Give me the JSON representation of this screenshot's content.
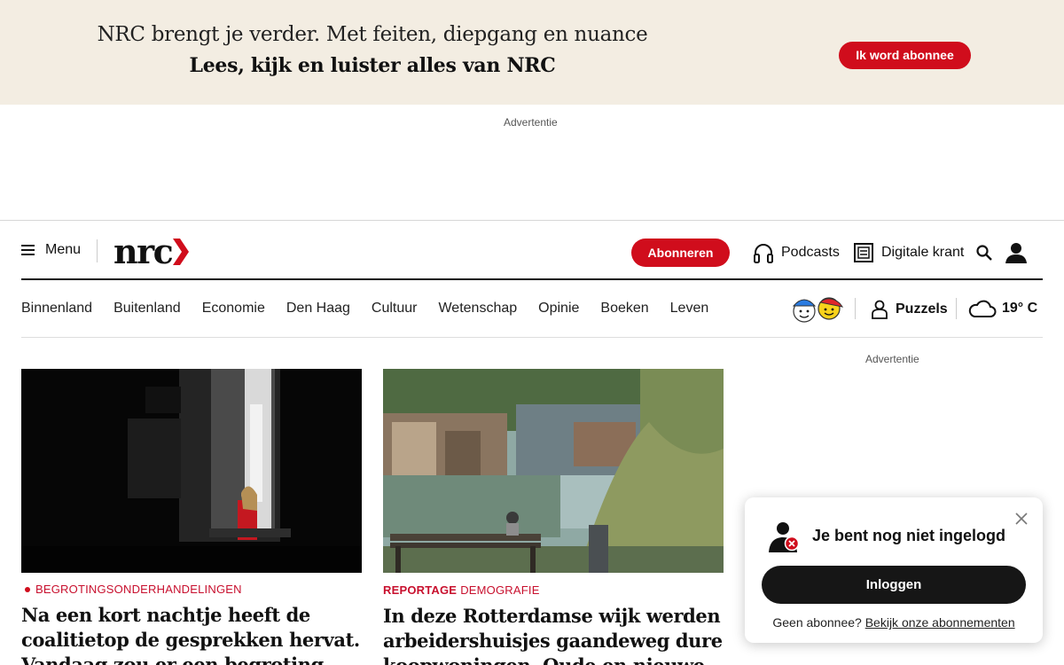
{
  "promo": {
    "line1": "NRC brengt je verder. Met feiten, diepgang en nuance",
    "line2": "Lees, kijk en luister alles van NRC",
    "button": "Ik word abonnee"
  },
  "ads": {
    "top_label": "Advertentie",
    "side_label": "Advertentie"
  },
  "header": {
    "menu_label": "Menu",
    "logo_text": "nrc",
    "subscribe_label": "Abonneren",
    "podcasts_label": "Podcasts",
    "digital_label": "Digitale krant",
    "icons": [
      "headphones-icon",
      "newspaper-icon",
      "search-icon",
      "user-icon"
    ]
  },
  "nav": {
    "items": [
      "Binnenland",
      "Buitenland",
      "Economie",
      "Den Haag",
      "Cultuur",
      "Wetenschap",
      "Opinie",
      "Boeken",
      "Leven"
    ],
    "puzzels_label": "Puzzels",
    "weather": "19° C"
  },
  "articles": [
    {
      "kicker": "",
      "label": "BEGROTINGSONDERHANDELINGEN",
      "title_lines": [
        "Na een kort nachtje heeft de",
        "coalitietop de gesprekken hervat.",
        "Vandaag zou er een begroting"
      ]
    },
    {
      "kicker": "REPORTAGE",
      "label": "DEMOGRAFIE",
      "title_lines": [
        "In deze Rotterdamse wijk werden",
        "arbeidershuisjes gaandeweg dure",
        "koopwoningen. Oude en nieuwe"
      ]
    }
  ],
  "popup": {
    "title": "Je bent nog niet ingelogd",
    "login_button": "Inloggen",
    "footer_text": "Geen abonnee?",
    "footer_link": "Bekijk onze abonnementen"
  },
  "colors": {
    "brand_red": "#d00d1c",
    "promo_bg": "#f3ede2",
    "dark_button": "#161616"
  }
}
